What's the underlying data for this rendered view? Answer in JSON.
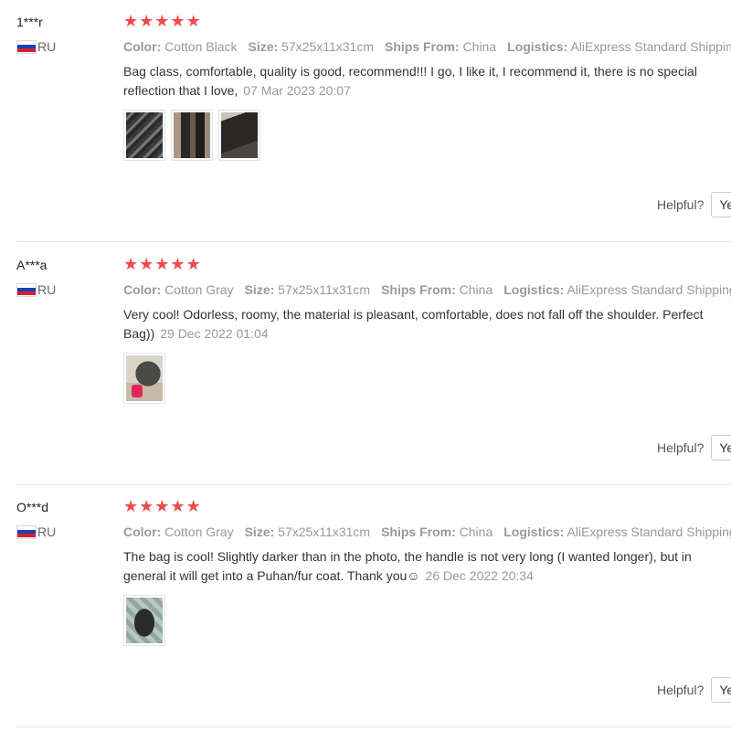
{
  "reviews": [
    {
      "user": "1***r",
      "country": "RU",
      "rating": 5,
      "meta": {
        "color_label": "Color:",
        "color_value": "Cotton Black",
        "size_label": "Size:",
        "size_value": "57x25x11x31cm",
        "ships_label": "Ships From:",
        "ships_value": "China",
        "logistics_label": "Logistics:",
        "logistics_value": "AliExpress Standard Shipping"
      },
      "text": "Bag class, comfortable, quality is good, recommend!!! I go, I like it, I recommend it, there is no special reflection that I love,",
      "date": "07 Mar 2023 20:07",
      "photo_count": 3,
      "helpful_label": "Helpful?",
      "yes_label": "Yes"
    },
    {
      "user": "A***a",
      "country": "RU",
      "rating": 5,
      "meta": {
        "color_label": "Color:",
        "color_value": "Cotton Gray",
        "size_label": "Size:",
        "size_value": "57x25x11x31cm",
        "ships_label": "Ships From:",
        "ships_value": "China",
        "logistics_label": "Logistics:",
        "logistics_value": "AliExpress Standard Shipping"
      },
      "text": "Very cool! Odorless, roomy, the material is pleasant, comfortable, does not fall off the shoulder. Perfect Bag))",
      "date": "29 Dec 2022 01:04",
      "photo_count": 1,
      "helpful_label": "Helpful?",
      "yes_label": "Yes"
    },
    {
      "user": "O***d",
      "country": "RU",
      "rating": 5,
      "meta": {
        "color_label": "Color:",
        "color_value": "Cotton Gray",
        "size_label": "Size:",
        "size_value": "57x25x11x31cm",
        "ships_label": "Ships From:",
        "ships_value": "China",
        "logistics_label": "Logistics:",
        "logistics_value": "AliExpress Standard Shipping"
      },
      "text": "The bag is cool! Slightly darker than in the photo, the handle is not very long (I wanted longer), but in general it will get into a Puhan/fur coat. Thank you☺",
      "date": "26 Dec 2022 20:34",
      "photo_count": 1,
      "helpful_label": "Helpful?",
      "yes_label": "Yes"
    }
  ],
  "star_glyph": "★",
  "colors": {
    "star": "#f04a4a",
    "muted": "#999999",
    "divider": "#e8e8e8"
  }
}
